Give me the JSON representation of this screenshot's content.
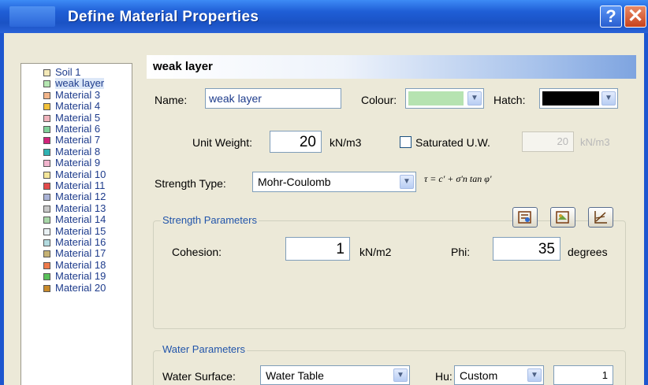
{
  "window": {
    "title": "Define Material Properties",
    "help_label": "?",
    "close_label": "✕"
  },
  "materials": [
    {
      "label": "Soil 1",
      "color": "#f4e9b8"
    },
    {
      "label": "weak layer",
      "color": "#b5e6b1"
    },
    {
      "label": "Material 3",
      "color": "#f2b58a"
    },
    {
      "label": "Material 4",
      "color": "#f3c23a"
    },
    {
      "label": "Material 5",
      "color": "#f0b3bc"
    },
    {
      "label": "Material 6",
      "color": "#7fd19a"
    },
    {
      "label": "Material 7",
      "color": "#d2237a"
    },
    {
      "label": "Material 8",
      "color": "#2fb3b3"
    },
    {
      "label": "Material 9",
      "color": "#f1b4cd"
    },
    {
      "label": "Material 10",
      "color": "#f4e69a"
    },
    {
      "label": "Material 11",
      "color": "#e34b4b"
    },
    {
      "label": "Material 12",
      "color": "#aab3d6"
    },
    {
      "label": "Material 13",
      "color": "#c8c8c8"
    },
    {
      "label": "Material 14",
      "color": "#a9d8a9"
    },
    {
      "label": "Material 15",
      "color": "#e9f1f4"
    },
    {
      "label": "Material 16",
      "color": "#b3dbe0"
    },
    {
      "label": "Material 17",
      "color": "#c6b274"
    },
    {
      "label": "Material 18",
      "color": "#ef7b4b"
    },
    {
      "label": "Material 19",
      "color": "#5ac15a"
    },
    {
      "label": "Material 20",
      "color": "#c98a2b"
    }
  ],
  "selected_material": "weak layer",
  "header": {
    "title": "weak layer"
  },
  "name": {
    "label": "Name:",
    "value": "weak layer"
  },
  "colour": {
    "label": "Colour:",
    "value_color": "#b6e3b1"
  },
  "hatch": {
    "label": "Hatch:",
    "value_color": "#000000"
  },
  "unit_weight": {
    "label": "Unit Weight:",
    "value": "20",
    "unit": "kN/m3"
  },
  "saturated": {
    "label": "Saturated U.W.",
    "checked": false,
    "value": "20",
    "unit": "kN/m3"
  },
  "strength_type": {
    "label": "Strength Type:",
    "value": "Mohr-Coulomb",
    "formula": "τ = c' + σ'n tan φ'"
  },
  "strength_params": {
    "title": "Strength Parameters",
    "cohesion_label": "Cohesion:",
    "cohesion_value": "1",
    "cohesion_unit": "kN/m2",
    "phi_label": "Phi:",
    "phi_value": "35",
    "phi_unit": "degrees"
  },
  "water_params": {
    "title": "Water Parameters",
    "surface_label": "Water Surface:",
    "surface_value": "Water Table",
    "hu_label": "Hu:",
    "hu_value": "Custom",
    "hu_number": "1"
  }
}
